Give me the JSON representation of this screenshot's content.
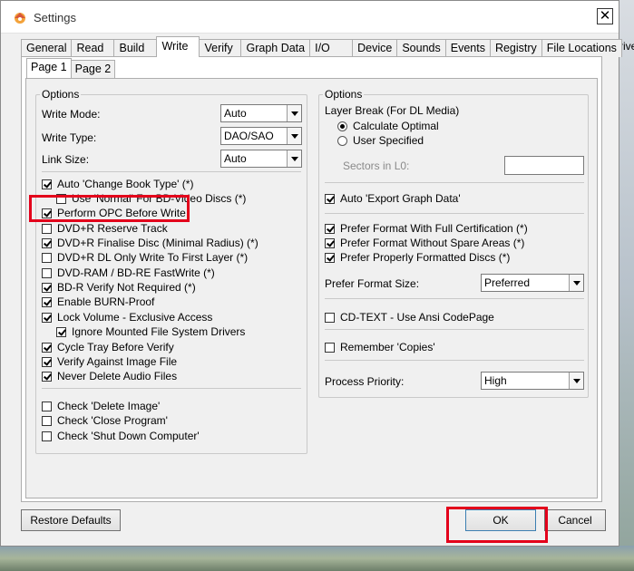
{
  "window": {
    "title": "Settings"
  },
  "tabs": [
    "General",
    "Read",
    "Build",
    "Write",
    "Verify",
    "Graph Data",
    "I/O",
    "Device",
    "Sounds",
    "Events",
    "Registry",
    "File Locations"
  ],
  "subtabs": [
    "Page 1",
    "Page 2"
  ],
  "left": {
    "legend": "Options",
    "write_mode": {
      "label": "Write Mode:",
      "value": "Auto"
    },
    "write_type": {
      "label": "Write Type:",
      "value": "DAO/SAO"
    },
    "link_size": {
      "label": "Link Size:",
      "value": "Auto"
    },
    "checks": [
      {
        "label": "Auto 'Change Book Type' (*)",
        "checked": true
      },
      {
        "label": "Use 'Normal' For BD-Video Discs (*)",
        "checked": false
      },
      {
        "label": "Perform OPC Before Write",
        "checked": true
      },
      {
        "label": "DVD+R Reserve Track",
        "checked": false
      },
      {
        "label": "DVD+R Finalise Disc (Minimal Radius) (*)",
        "checked": true
      },
      {
        "label": "DVD+R DL Only Write To First Layer (*)",
        "checked": false
      },
      {
        "label": "DVD-RAM / BD-RE FastWrite (*)",
        "checked": false
      },
      {
        "label": "BD-R Verify Not Required (*)",
        "checked": true
      },
      {
        "label": "Enable BURN-Proof",
        "checked": true
      },
      {
        "label": "Lock Volume - Exclusive Access",
        "checked": true
      },
      {
        "label": "Ignore Mounted File System Drivers",
        "checked": true
      },
      {
        "label": "Cycle Tray Before Verify",
        "checked": true
      },
      {
        "label": "Verify Against Image File",
        "checked": true
      },
      {
        "label": "Never Delete Audio Files",
        "checked": true
      }
    ],
    "checks2": [
      {
        "label": "Check 'Delete Image'",
        "checked": false
      },
      {
        "label": "Check 'Close Program'",
        "checked": false
      },
      {
        "label": "Check 'Shut Down Computer'",
        "checked": false
      }
    ]
  },
  "right": {
    "legend": "Options",
    "layer_break": "Layer Break (For DL Media)",
    "radio_calc": "Calculate Optimal",
    "radio_user": "User Specified",
    "sectors_label": "Sectors in L0:",
    "auto_export": "Auto 'Export Graph Data'",
    "pref1": "Prefer Format With Full Certification (*)",
    "pref2": "Prefer Format Without Spare Areas (*)",
    "pref3": "Prefer Properly Formatted Discs (*)",
    "pref_size_label": "Prefer Format Size:",
    "pref_size_value": "Preferred",
    "cdtext": "CD-TEXT - Use Ansi CodePage",
    "remember": "Remember 'Copies'",
    "priority_label": "Process Priority:",
    "priority_value": "High"
  },
  "buttons": {
    "restore": "Restore Defaults",
    "ok": "OK",
    "cancel": "Cancel"
  },
  "desktop": {
    "partial_text": "rive"
  },
  "colors": {
    "highlight": "#e3001b",
    "accent": "#3c7fb1"
  }
}
